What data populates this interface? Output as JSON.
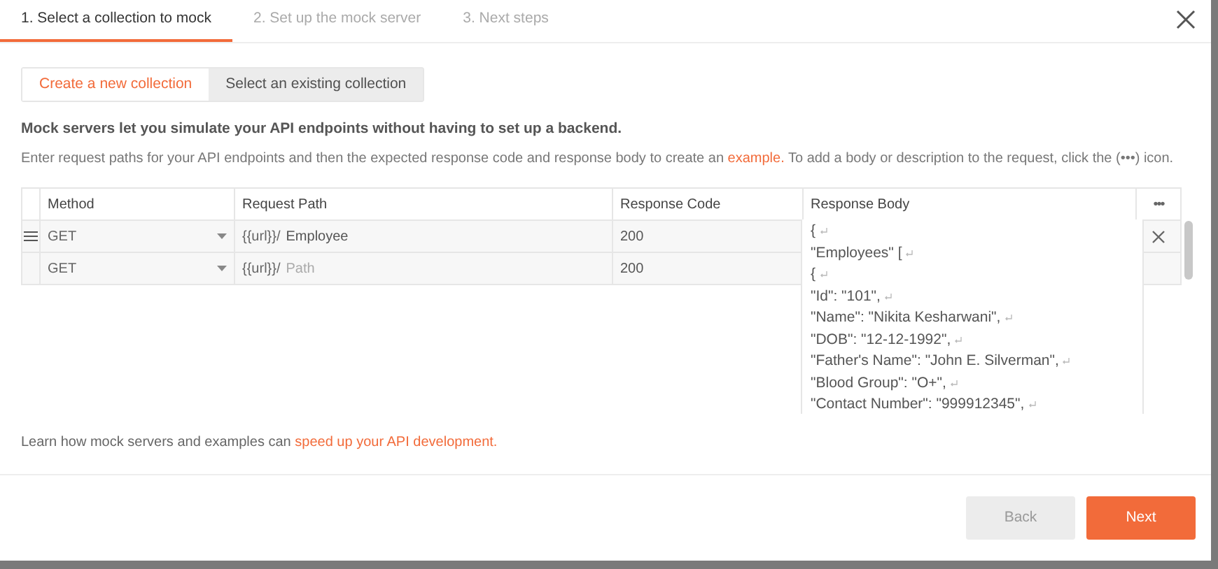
{
  "steps": [
    {
      "label": "1. Select a collection to mock",
      "selected": true
    },
    {
      "label": "2. Set up the mock server",
      "selected": false
    },
    {
      "label": "3. Next steps",
      "selected": false
    }
  ],
  "source_tabs": [
    {
      "label": "Create a new collection",
      "selected": true
    },
    {
      "label": "Select an existing collection",
      "selected": false
    }
  ],
  "intro": "Mock servers let you simulate your API endpoints without having to set up a backend.",
  "instructions": {
    "before": "Enter request paths for your API endpoints and then the expected response code and response body to create an",
    "link": "example.",
    "after": "To add a body or description to the request, click the (•••) icon."
  },
  "table": {
    "columns": [
      "Method",
      "Request Path",
      "Response Code",
      "Response Body"
    ],
    "more": "•••",
    "rows": [
      {
        "method": "GET",
        "prefix": "{{url}}/",
        "path": "Employee",
        "path_placeholder": "",
        "code": "200"
      },
      {
        "method": "GET",
        "prefix": "{{url}}/",
        "path": "",
        "path_placeholder": "Path",
        "code": "200"
      }
    ]
  },
  "response_body_editor": [
    "{",
    "\"Employees\" [",
    "{",
    "\"Id\": \"101\",",
    "\"Name\": \"Nikita Kesharwani\",",
    "\"DOB\": \"12-12-1992\",",
    "\"Father's Name\": \"John E. Silverman\",",
    "\"Blood Group\": \"O+\",",
    "\"Contact Number\": \"999912345\","
  ],
  "footer_note": {
    "before": "Learn how mock servers and examples can",
    "link": "speed up your API development."
  },
  "buttons": {
    "back": "Back",
    "next": "Next"
  }
}
